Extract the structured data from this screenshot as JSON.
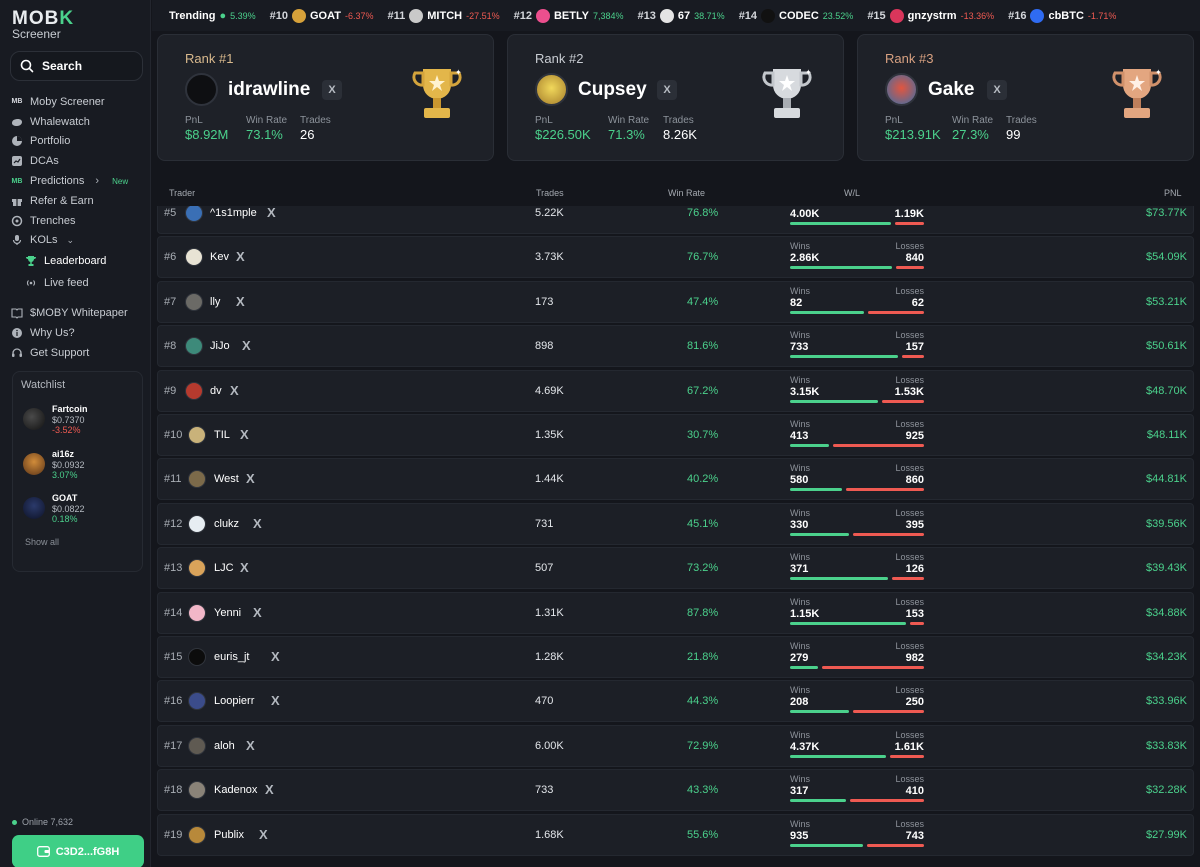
{
  "brand": {
    "logo_text": "MOB",
    "logo_accent": "K",
    "subtitle": "Screener"
  },
  "search": {
    "label": "Search"
  },
  "nav": {
    "items": [
      {
        "label": "Moby Screener",
        "icon": "moby-logo-icon"
      },
      {
        "label": "Whalewatch",
        "icon": "whale-icon"
      },
      {
        "label": "Portfolio",
        "icon": "pie-chart-icon"
      },
      {
        "label": "DCAs",
        "icon": "dca-icon"
      },
      {
        "label": "Predictions",
        "icon": "moby-logo-icon",
        "badge": "New"
      },
      {
        "label": "Refer & Earn",
        "icon": "gift-icon"
      },
      {
        "label": "Trenches",
        "icon": "trenches-icon"
      },
      {
        "label": "KOLs",
        "icon": "microphone-icon"
      },
      {
        "label": "Leaderboard",
        "icon": "trophy-icon"
      },
      {
        "label": "Live feed",
        "icon": "broadcast-icon"
      },
      {
        "label": "$MOBY Whitepaper",
        "icon": "book-icon"
      },
      {
        "label": "Why Us?",
        "icon": "info-icon"
      },
      {
        "label": "Get Support",
        "icon": "headset-icon"
      }
    ]
  },
  "watchlist": {
    "title": "Watchlist",
    "items": [
      {
        "name": "Fartcoin",
        "price": "$0.7370",
        "change": "-3.52%"
      },
      {
        "name": "ai16z",
        "price": "$0.0932",
        "change": "3.07%"
      },
      {
        "name": "GOAT",
        "price": "$0.0822",
        "change": "0.18%"
      }
    ],
    "show_all": "Show all"
  },
  "footer": {
    "online": "Online 7,632",
    "wallet": "C3D2...fG8H"
  },
  "ticker": {
    "label": "Trending",
    "first_change": "5.39%",
    "items": [
      {
        "rank": "#10",
        "name": "GOAT",
        "change": "-6.37%",
        "dir": "neg",
        "color": "#d6a13a"
      },
      {
        "rank": "#11",
        "name": "MITCH",
        "change": "-27.51%",
        "dir": "neg",
        "color": "#c9c9c9"
      },
      {
        "rank": "#12",
        "name": "BETLY",
        "change": "7,384%",
        "dir": "pos",
        "color": "#ec4f8e"
      },
      {
        "rank": "#13",
        "name": "67",
        "change": "38.71%",
        "dir": "pos",
        "color": "#e4e4e4"
      },
      {
        "rank": "#14",
        "name": "CODEC",
        "change": "23.52%",
        "dir": "pos",
        "color": "#111111"
      },
      {
        "rank": "#15",
        "name": "gnzystrm",
        "change": "-13.36%",
        "dir": "neg",
        "color": "#d9365b"
      },
      {
        "rank": "#16",
        "name": "cbBTC",
        "change": "-1.71%",
        "dir": "neg",
        "color": "#2f6bf2"
      }
    ]
  },
  "podium": [
    {
      "rank": "Rank #1",
      "name": "idrawline",
      "x": "X",
      "pnl_label": "PnL",
      "pnl": "$8.92M",
      "wr_label": "Win Rate",
      "win_rate": "73.1%",
      "tr_label": "Trades",
      "trades": "26",
      "trophy": "gold"
    },
    {
      "rank": "Rank #2",
      "name": "Cupsey",
      "x": "X",
      "pnl_label": "PnL",
      "pnl": "$226.50K",
      "wr_label": "Win Rate",
      "win_rate": "71.3%",
      "tr_label": "Trades",
      "trades": "8.26K",
      "trophy": "silver"
    },
    {
      "rank": "Rank #3",
      "name": "Gake",
      "x": "X",
      "pnl_label": "PnL",
      "pnl": "$213.91K",
      "wr_label": "Win Rate",
      "win_rate": "27.3%",
      "tr_label": "Trades",
      "trades": "99",
      "trophy": "bronze"
    }
  ],
  "table": {
    "headers": {
      "trader": "Trader",
      "trades": "Trades",
      "win_rate": "Win Rate",
      "wl": "W/L",
      "pnl": "PNL"
    },
    "wins_label": "Wins",
    "losses_label": "Losses",
    "x_label": "X",
    "rows": [
      {
        "rank": "#5",
        "name": "^1s1mple",
        "trades": "5.22K",
        "win_rate": "76.8%",
        "wins": "4.00K",
        "losses": "1.19K",
        "win_frac": 0.771,
        "pnl": "$73.77K",
        "av": "#3a6fb5"
      },
      {
        "rank": "#6",
        "name": "Kev",
        "trades": "3.73K",
        "win_rate": "76.7%",
        "wins": "2.86K",
        "losses": "840",
        "win_frac": 0.773,
        "pnl": "$54.09K",
        "av": "#e8e3d4"
      },
      {
        "rank": "#7",
        "name": "lly",
        "trades": "173",
        "win_rate": "47.4%",
        "wins": "82",
        "losses": "62",
        "win_frac": 0.569,
        "pnl": "$53.21K",
        "av": "#6b6a66"
      },
      {
        "rank": "#8",
        "name": "JiJo",
        "trades": "898",
        "win_rate": "81.6%",
        "wins": "733",
        "losses": "157",
        "win_frac": 0.824,
        "pnl": "$50.61K",
        "av": "#3d8a7a"
      },
      {
        "rank": "#9",
        "name": "dv",
        "trades": "4.69K",
        "win_rate": "67.2%",
        "wins": "3.15K",
        "losses": "1.53K",
        "win_frac": 0.673,
        "pnl": "$48.70K",
        "av": "#b63a2e"
      },
      {
        "rank": "#10",
        "name": "TIL",
        "trades": "1.35K",
        "win_rate": "30.7%",
        "wins": "413",
        "losses": "925",
        "win_frac": 0.309,
        "pnl": "$48.11K",
        "av": "#c9b27a"
      },
      {
        "rank": "#11",
        "name": "West",
        "trades": "1.44K",
        "win_rate": "40.2%",
        "wins": "580",
        "losses": "860",
        "win_frac": 0.403,
        "pnl": "$44.81K",
        "av": "#7c6a4a"
      },
      {
        "rank": "#12",
        "name": "clukz",
        "trades": "731",
        "win_rate": "45.1%",
        "wins": "330",
        "losses": "395",
        "win_frac": 0.455,
        "pnl": "$39.56K",
        "av": "#e7edf2"
      },
      {
        "rank": "#13",
        "name": "LJC",
        "trades": "507",
        "win_rate": "73.2%",
        "wins": "371",
        "losses": "126",
        "win_frac": 0.746,
        "pnl": "$39.43K",
        "av": "#d9a35a"
      },
      {
        "rank": "#14",
        "name": "Yenni",
        "trades": "1.31K",
        "win_rate": "87.8%",
        "wins": "1.15K",
        "losses": "153",
        "win_frac": 0.883,
        "pnl": "$34.88K",
        "av": "#f2b7c8"
      },
      {
        "rank": "#15",
        "name": "euris_jt",
        "trades": "1.28K",
        "win_rate": "21.8%",
        "wins": "279",
        "losses": "982",
        "win_frac": 0.221,
        "pnl": "$34.23K",
        "av": "#0c0c0c"
      },
      {
        "rank": "#16",
        "name": "Loopierr",
        "trades": "470",
        "win_rate": "44.3%",
        "wins": "208",
        "losses": "250",
        "win_frac": 0.454,
        "pnl": "$33.96K",
        "av": "#3b4c8a"
      },
      {
        "rank": "#17",
        "name": "aloh",
        "trades": "6.00K",
        "win_rate": "72.9%",
        "wins": "4.37K",
        "losses": "1.61K",
        "win_frac": 0.731,
        "pnl": "$33.83K",
        "av": "#5f5a52"
      },
      {
        "rank": "#18",
        "name": "Kadenox",
        "trades": "733",
        "win_rate": "43.3%",
        "wins": "317",
        "losses": "410",
        "win_frac": 0.436,
        "pnl": "$32.28K",
        "av": "#8a8378"
      },
      {
        "rank": "#19",
        "name": "Publix",
        "trades": "1.68K",
        "win_rate": "55.6%",
        "wins": "935",
        "losses": "743",
        "win_frac": 0.557,
        "pnl": "$27.99K",
        "av": "#b8893a"
      }
    ]
  },
  "colors": {
    "accent": "#4bd18c",
    "negative": "#ef5a52",
    "background": "#14161c"
  }
}
